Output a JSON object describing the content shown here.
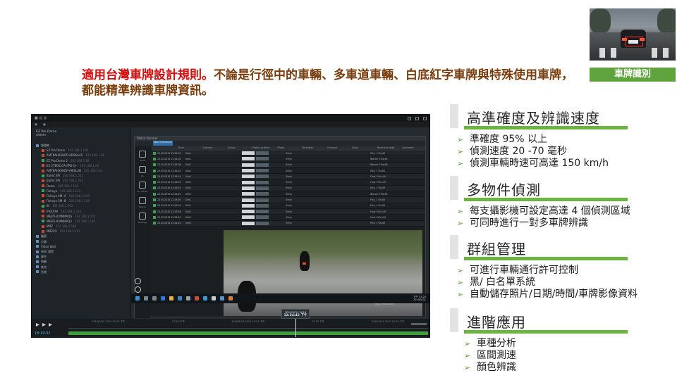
{
  "badge": {
    "label": "車牌識別"
  },
  "headline": {
    "part_red": "適用台灣車牌設計規則。",
    "part_brown": "不論是行徑中的車輛、多車道車輛、白底紅字車牌與特殊使用車牌，都能精準辨識車牌資訊。"
  },
  "sections": [
    {
      "title": "高準確度及辨識速度",
      "bullets": [
        "準確度 95% 以上",
        "偵測速度 20 -70 毫秒",
        "偵測車輛時速可高達 150 km/h"
      ]
    },
    {
      "title": "多物件偵測",
      "bullets": [
        "每支攝影機可設定高達 4 個偵測區域",
        "可同時進行一對多車牌辨識"
      ]
    },
    {
      "title": "群組管理",
      "bullets": [
        "可進行車輛通行許可控制",
        "黑/ 白名單系統",
        "自動儲存照片/日期/時間/車牌影像資料"
      ]
    },
    {
      "title": "進階應用",
      "bullets": [
        "車種分析",
        "區間測速",
        "顏色辨識"
      ]
    }
  ],
  "app": {
    "user_line1": "EZ Pro Demo",
    "user_line2": "admin",
    "tree": [
      {
        "label": "頻道樹",
        "ip": ""
      },
      {
        "label": "EZ Pro Demo",
        "ip": "192.168.1.100"
      },
      {
        "label": "AMTKAHXSHDP-ARDSAAS",
        "ip": "192.168.1.86"
      },
      {
        "label": "EZ Pro Demo 2",
        "ip": "192.168.1.66"
      },
      {
        "label": "EX 2TE0637A-FPD-1+",
        "ip": "192.168.1.64"
      },
      {
        "label": "AMTKAHXSHDP-AIRSLAB",
        "ip": "192.168.1.65"
      },
      {
        "label": "Bullet 5M",
        "ip": "192.168.1.211"
      },
      {
        "label": "Bullet 5M",
        "ip": "192.168.1.201"
      },
      {
        "label": "Dome",
        "ip": "192.168.1.124"
      },
      {
        "label": "Fisheye",
        "ip": "192.168.1.112"
      },
      {
        "label": "Fisheye 5M -A",
        "ip": "192.168.1.200"
      },
      {
        "label": "Fisheye 5M -B",
        "ip": "192.168.1.148"
      },
      {
        "label": "IB",
        "ip": "192.168.1.203"
      },
      {
        "label": "IPDOON",
        "ip": "192.168.1.205"
      },
      {
        "label": "MEBTI-ILMMMAQA",
        "ip": "192.168.1.206"
      },
      {
        "label": "MEBTI-ILMMMAQ2",
        "ip": "192.168.1.185"
      },
      {
        "label": "MBZ",
        "ip": "192.168.1.186"
      },
      {
        "label": "MBZ2O",
        "ip": "192.168.1.187"
      },
      {
        "label": "圖層",
        "ip": ""
      },
      {
        "label": "分類",
        "ip": ""
      },
      {
        "label": "Video Wall",
        "ip": ""
      },
      {
        "label": "Web 瀏覽",
        "ip": ""
      },
      {
        "label": "事件",
        "ip": ""
      },
      {
        "label": "地圖",
        "ip": ""
      },
      {
        "label": "其他",
        "ip": ""
      },
      {
        "label": "系統",
        "ip": ""
      }
    ],
    "panel_title": "Watch Number",
    "tab_label": "Watch Number",
    "side_caps": [
      "View",
      "Go",
      "Lic Admin",
      "Search",
      "Settings"
    ],
    "table_headers": [
      "",
      "Time",
      "Camera",
      "Group",
      "Plate Location",
      "Photo",
      "Direction",
      "Channel",
      "Zone",
      "Technical data",
      "Comment"
    ],
    "rows": [
      {
        "time": "25.05.2019 12:26:00",
        "camera": "Site1",
        "dir": "Entry",
        "data": "Prio: 1 Vis:63"
      },
      {
        "time": "25.05.2019 12:26:05",
        "camera": "Site1",
        "dir": "Entry",
        "data": "Bbnval Y:Vis:65"
      },
      {
        "time": "25.05.2019 12:26:08",
        "camera": "Site1",
        "dir": "Entry",
        "data": "Bbnval Y:Vis:60"
      },
      {
        "time": "25.05.2019 12:26:10",
        "camera": "Site1",
        "dir": "Entry",
        "data": "Prio: 1 Vis:61"
      },
      {
        "time": "25.05.2019 12:26:14",
        "camera": "Site1",
        "dir": "Entry",
        "data": "Flow Y:Vis:4:9"
      },
      {
        "time": "25.05.2019 12:26:16",
        "camera": "Site1",
        "dir": "Entry",
        "data": "Flow Y:Vis:4:9"
      },
      {
        "time": "25.05.2019 12:26:20",
        "camera": "Site1",
        "dir": "Entry",
        "data": "Prio: 1 Vis:63"
      },
      {
        "time": "25.05.2019 12:26:25",
        "camera": "Site1",
        "dir": "Entry",
        "data": "Bbnval Y:Vis:65"
      },
      {
        "time": "25.05.2019 12:26:30",
        "camera": "Site1",
        "dir": "Entry",
        "data": "Prio: 1 Vis:63"
      },
      {
        "time": "25.05.2019 12:26:34",
        "camera": "Site1",
        "dir": "Entry",
        "data": "Prio: 1 Vis:63"
      },
      {
        "time": "25.05.2019 12:26:38",
        "camera": "Site1",
        "dir": "Entry",
        "data": "Flow Y:Vis:4:9"
      },
      {
        "time": "25.05.2019 12:26:40",
        "camera": "Site1",
        "dir": "Entry",
        "data": "Flow Y:Vis:4:9"
      },
      {
        "time": "25.05.2019 12:26:44",
        "camera": "Site1",
        "dir": "Entry",
        "data": "Prio: 1 Vis:63"
      }
    ],
    "watermark": "啟用 Windows",
    "tray_time": "下午 12:24",
    "tray_date": "2019/5/31",
    "stamp_date": "2019/5/31 2019",
    "stamp_time": "12:24:42 下午",
    "ruler_labels": [
      "2019/5/31 2019 12:23 下午",
      "12:24 下午",
      "2019/5/31 2019 12:24 下午",
      "12:25 下午",
      "2019/5/31 2019 12:25 下午"
    ],
    "playback_time": "18:19:32"
  }
}
